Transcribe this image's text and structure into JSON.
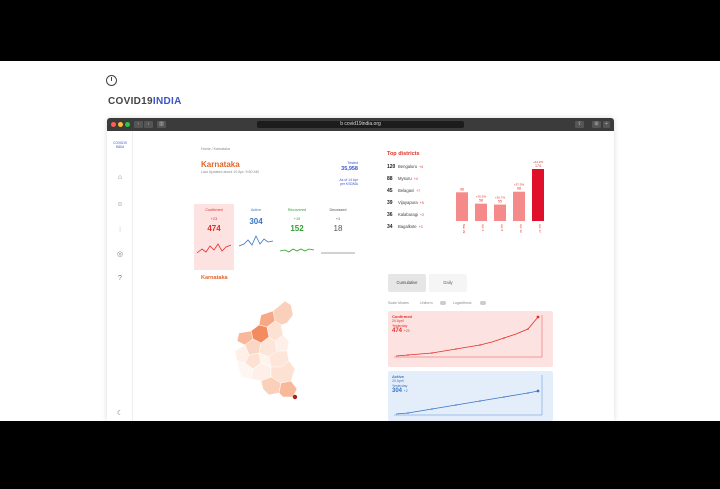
{
  "brand": {
    "prefix": "COVID19",
    "highlight": "INDIA"
  },
  "browser": {
    "url": "b covid19india.org"
  },
  "sidebar": {
    "title": "COVID19 INDIA"
  },
  "page": {
    "breadcrumb": "Home / Karnataka",
    "state_name": "Karnataka",
    "last_updated": "Last Updated about 10 Apr, 9:50 AM",
    "tested_label": "Tested",
    "tested_value": "35,958",
    "tested_note": "As of 14 Apr",
    "tested_source": "per KSDMA"
  },
  "stats": [
    {
      "label": "Confirmed",
      "delta": "+23",
      "value": "474"
    },
    {
      "label": "Active",
      "delta": "",
      "value": "304"
    },
    {
      "label": "Recovered",
      "delta": "+19",
      "value": "152"
    },
    {
      "label": "Deceased",
      "delta": "+1",
      "value": "18"
    }
  ],
  "top_districts": {
    "title": "Top districts",
    "rows": [
      {
        "count": "120",
        "name": "Bengaluru",
        "delta": "+4"
      },
      {
        "count": "88",
        "name": "Mysuru",
        "delta": "+4"
      },
      {
        "count": "45",
        "name": "Belagavi",
        "delta": "+7"
      },
      {
        "count": "39",
        "name": "Vijayapura",
        "delta": "+5"
      },
      {
        "count": "36",
        "name": "Kalaburagi",
        "delta": "+2"
      },
      {
        "count": "34",
        "name": "Bagalkote",
        "delta": "+3"
      }
    ],
    "bars": [
      {
        "value": "96",
        "delta": "",
        "label": "Mar 29"
      },
      {
        "value": "58",
        "delta": "+20.5%",
        "label": "Apr 3"
      },
      {
        "value": "55",
        "delta": "+30.7%",
        "label": "Apr 8"
      },
      {
        "value": "98",
        "delta": "+37.5%",
        "label": "Apr 12"
      },
      {
        "value": "174",
        "delta": "+44.3%",
        "label": "Apr 17"
      }
    ]
  },
  "map": {
    "title": "Karnataka"
  },
  "chart_tabs": {
    "cumulative": "Cumulative",
    "daily": "Daily"
  },
  "chart_options": {
    "scale": "Scale Modes",
    "uniform": "Uniform",
    "log": "Logarithmic"
  },
  "panels": {
    "confirmed": {
      "label": "Confirmed",
      "sub": "20 April",
      "sub2": "Yesterday",
      "value": "474",
      "delta": "+23"
    },
    "active": {
      "label": "Active",
      "sub": "20 April",
      "sub2": "Yesterday",
      "value": "304",
      "delta": "+2"
    }
  },
  "colors": {
    "confirmed": "#e23028",
    "active": "#3a75c4",
    "recovered": "#2fa02f",
    "deceased": "#6c757d",
    "brand": "#3a54c8"
  }
}
